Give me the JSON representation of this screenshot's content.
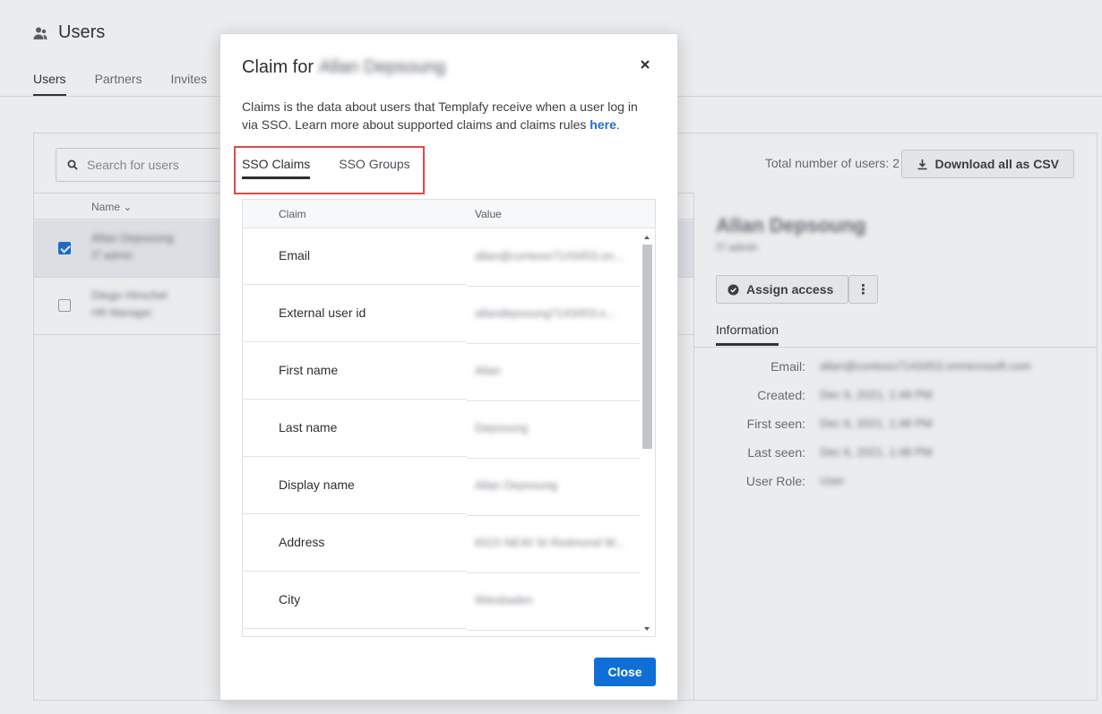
{
  "page": {
    "title": "Users",
    "tabs": [
      "Users",
      "Partners",
      "Invites"
    ],
    "search_placeholder": "Search for users",
    "total_label": "Total number of users: 2",
    "download_label": "Download all as CSV",
    "list_header": "Name",
    "rows": [
      {
        "name": "Allan Depsoung",
        "role": "IT admin",
        "checked": true
      },
      {
        "name": "Diego Hirschel",
        "role": "HR Manager",
        "checked": false
      }
    ],
    "detail": {
      "name": "Allan Depsoung",
      "role": "IT admin",
      "assign_label": "Assign access",
      "info_tab": "Information",
      "info": [
        {
          "key": "Email:",
          "value": "allan@contoso7143453.onmicrosoft.com"
        },
        {
          "key": "Created:",
          "value": "Dec 6, 2021, 1:48 PM"
        },
        {
          "key": "First seen:",
          "value": "Dec 6, 2021, 1:48 PM"
        },
        {
          "key": "Last seen:",
          "value": "Dec 6, 2021, 1:48 PM"
        },
        {
          "key": "User Role:",
          "value": "User"
        }
      ]
    }
  },
  "modal": {
    "title_prefix": "Claim for",
    "title_name": "Allan Depsoung",
    "description": "Claims is the data about users that Templafy receive when a user log in via SSO. Learn more about supported claims and claims rules ",
    "link_text": "here",
    "tabs": [
      "SSO Claims",
      "SSO Groups"
    ],
    "columns": [
      "Claim",
      "Value"
    ],
    "claims": [
      {
        "claim": "Email",
        "value": "allan@contoso7143453.on..."
      },
      {
        "claim": "External user id",
        "value": "allandepsoung7143453.o..."
      },
      {
        "claim": "First name",
        "value": "Allan"
      },
      {
        "claim": "Last name",
        "value": "Depsoung"
      },
      {
        "claim": "Display name",
        "value": "Allan Depsoung"
      },
      {
        "claim": "Address",
        "value": "8315 NE40 St Redmond W..."
      },
      {
        "claim": "City",
        "value": "Wiesbaden"
      }
    ],
    "close_label": "Close"
  },
  "colors": {
    "accent": "#0f6fd6",
    "highlight": "#e04848"
  }
}
